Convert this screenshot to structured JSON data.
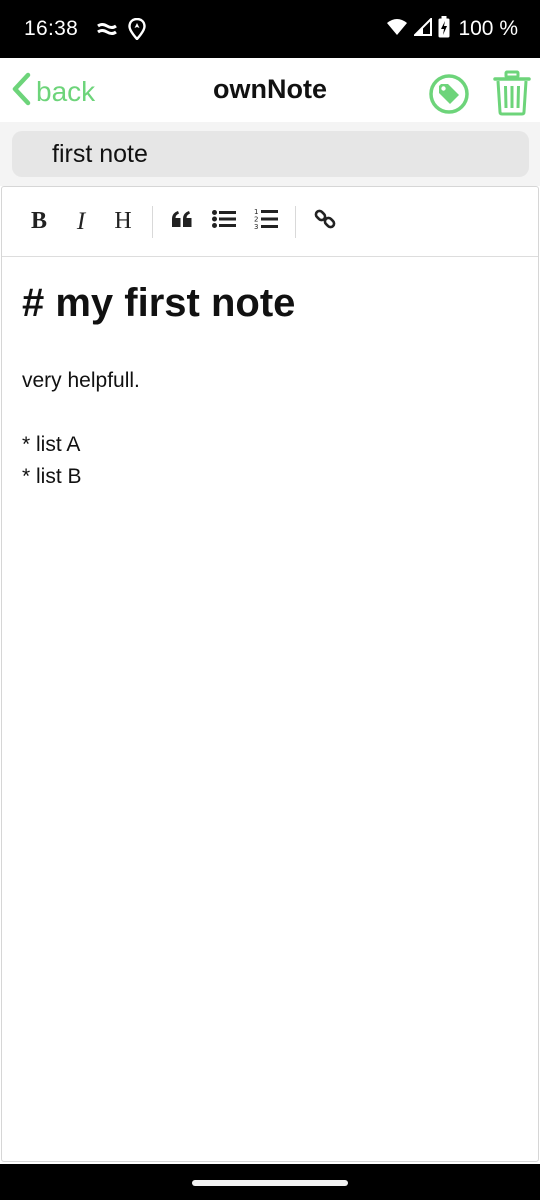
{
  "status_bar": {
    "time": "16:38",
    "battery": "100 %",
    "icons": [
      "messages-icon",
      "location-icon",
      "wifi-icon",
      "signal-icon",
      "battery-charging-icon"
    ]
  },
  "header": {
    "back_label": "back",
    "title": "ownNote",
    "accent_color": "#6dd47a",
    "actions": [
      "tag-icon",
      "trash-icon"
    ]
  },
  "note": {
    "title_value": "first note"
  },
  "toolbar": {
    "bold": "B",
    "italic": "I",
    "heading": "H",
    "tools": [
      "quote-icon",
      "bullet-list-icon",
      "numbered-list-icon",
      "link-icon"
    ]
  },
  "content": {
    "heading": "# my first note",
    "lines": [
      "very helpfull.",
      "",
      "* list A",
      "* list B"
    ]
  }
}
